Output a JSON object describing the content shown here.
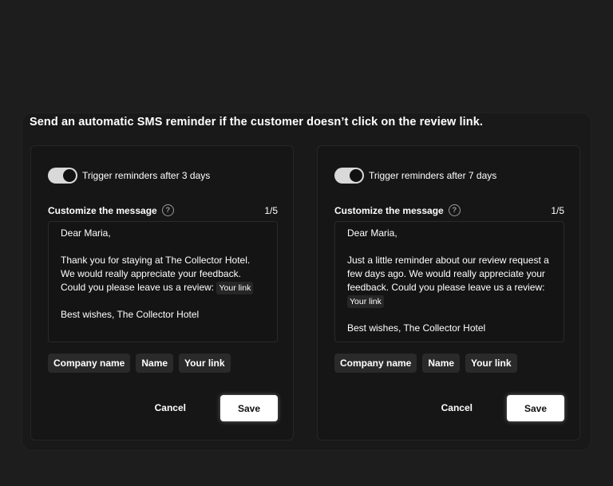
{
  "headline": "Send an automatic SMS reminder if the customer doesn’t click on the review link.",
  "panels": [
    {
      "toggle_on": true,
      "toggle_label": "Trigger reminders after 3 days",
      "customize_label": "Customize the message",
      "help_icon": "question-circle-icon",
      "counter": "1/5",
      "message": {
        "greeting": "Dear Maria,",
        "body": "Thank you for staying at The Collector Hotel. We would really appreciate your feedback. Could you please leave us a review:",
        "link_tag": "Your link",
        "signoff": "Best wishes, The Collector Hotel"
      },
      "chips": [
        "Company name",
        "Name",
        "Your link"
      ],
      "cancel_label": "Cancel",
      "save_label": "Save"
    },
    {
      "toggle_on": true,
      "toggle_label": "Trigger reminders after 7 days",
      "customize_label": "Customize the message",
      "help_icon": "question-circle-icon",
      "counter": "1/5",
      "message": {
        "greeting": "Dear Maria,",
        "body": "Just a little reminder about our review request a few days ago. We would really appreciate your feedback. Could you please leave us a review:",
        "link_tag": "Your link",
        "signoff": "Best wishes, The Collector Hotel"
      },
      "chips": [
        "Company name",
        "Name",
        "Your link"
      ],
      "cancel_label": "Cancel",
      "save_label": "Save"
    }
  ]
}
